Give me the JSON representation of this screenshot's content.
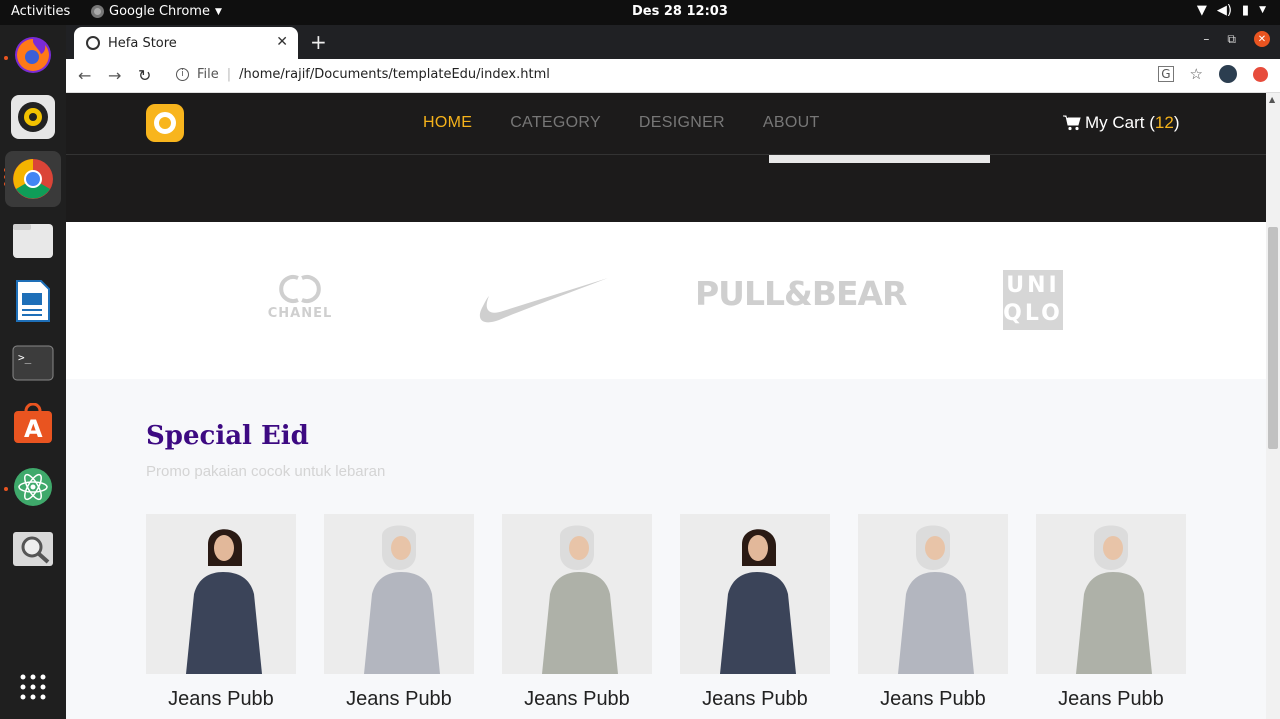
{
  "os": {
    "activities": "Activities",
    "app_name": "Google Chrome",
    "clock": "Des 28  12:03"
  },
  "browser": {
    "tab_title": "Hefa Store",
    "file_label": "File",
    "url": "/home/rajif/Documents/templateEdu/index.html"
  },
  "site": {
    "nav": [
      "HOME",
      "CATEGORY",
      "DESIGNER",
      "ABOUT"
    ],
    "cart_label": "My Cart (",
    "cart_count": "12",
    "cart_close": ")",
    "brands": [
      "CHANEL",
      "PULL&BEAR",
      "UNI",
      "QLO"
    ],
    "section_title": "Special Eid",
    "section_subtitle": "Promo pakaian cocok untuk lebaran",
    "products": [
      {
        "name": "Jeans Pubb",
        "color": "#3b4459",
        "hijab": false
      },
      {
        "name": "Jeans Pubb",
        "color": "#b3b6bf",
        "hijab": true
      },
      {
        "name": "Jeans Pubb",
        "color": "#aeb1a8",
        "hijab": true
      },
      {
        "name": "Jeans Pubb",
        "color": "#3b4459",
        "hijab": false
      },
      {
        "name": "Jeans Pubb",
        "color": "#b3b6bf",
        "hijab": true
      },
      {
        "name": "Jeans Pubb",
        "color": "#aeb1a8",
        "hijab": true
      }
    ]
  },
  "colors": {
    "accent": "#f5b21b",
    "title": "#3d0a82",
    "ubuntu_orange": "#e95420"
  }
}
